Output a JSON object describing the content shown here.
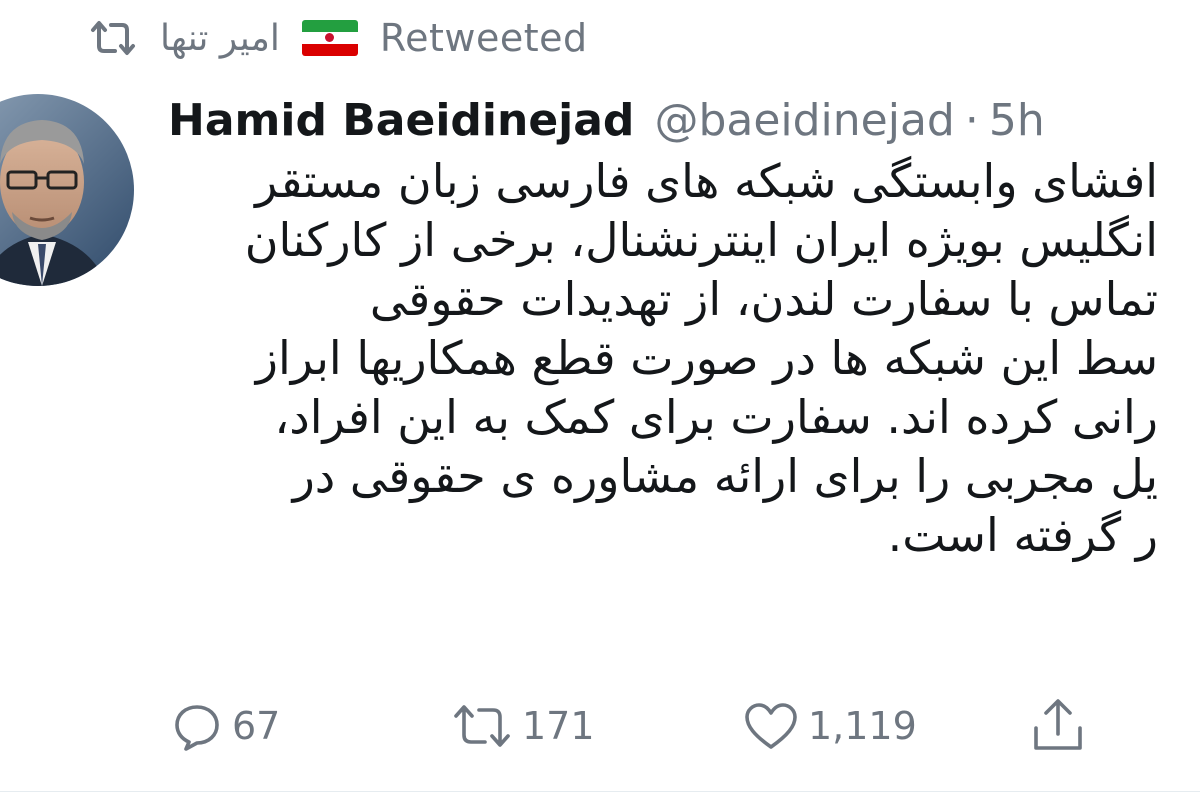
{
  "retweet_banner": {
    "label": "Retweeted",
    "retweeter_name": "امیر تنها",
    "flag_emoji": "iran-flag",
    "icon": "retweet-icon"
  },
  "tweet": {
    "author_name": "Hamid Baeidinejad",
    "author_handle": "@baeidinejad",
    "separator": "·",
    "time_ago": "5h",
    "avatar_icon": "profile-photo",
    "body_lines": [
      "افشای وابستگی شبکه های فارسی زبان مستقر",
      "انگلیس بویژه ایران اینترنشنال، برخی از کارکنان",
      "تماس با سفارت لندن، از تهدیدات حقوقی",
      "سط این شبکه ها در صورت قطع همکاریها ابراز",
      "رانی کرده اند. سفارت برای کمک به این افراد،",
      "یل مجربی را برای ارائه مشاوره ی حقوقی در",
      "ر گرفته است."
    ]
  },
  "actions": {
    "reply": {
      "icon": "reply-icon",
      "count": "67"
    },
    "retweet": {
      "icon": "retweet-icon",
      "count": "171"
    },
    "like": {
      "icon": "heart-icon",
      "count": "1,119"
    },
    "share": {
      "icon": "share-icon"
    }
  },
  "colors": {
    "text_primary": "#14171a",
    "text_secondary": "#6e7680",
    "divider": "#e6ecf0",
    "flag_green": "#239f40",
    "flag_white": "#ffffff",
    "flag_red": "#da0000"
  }
}
